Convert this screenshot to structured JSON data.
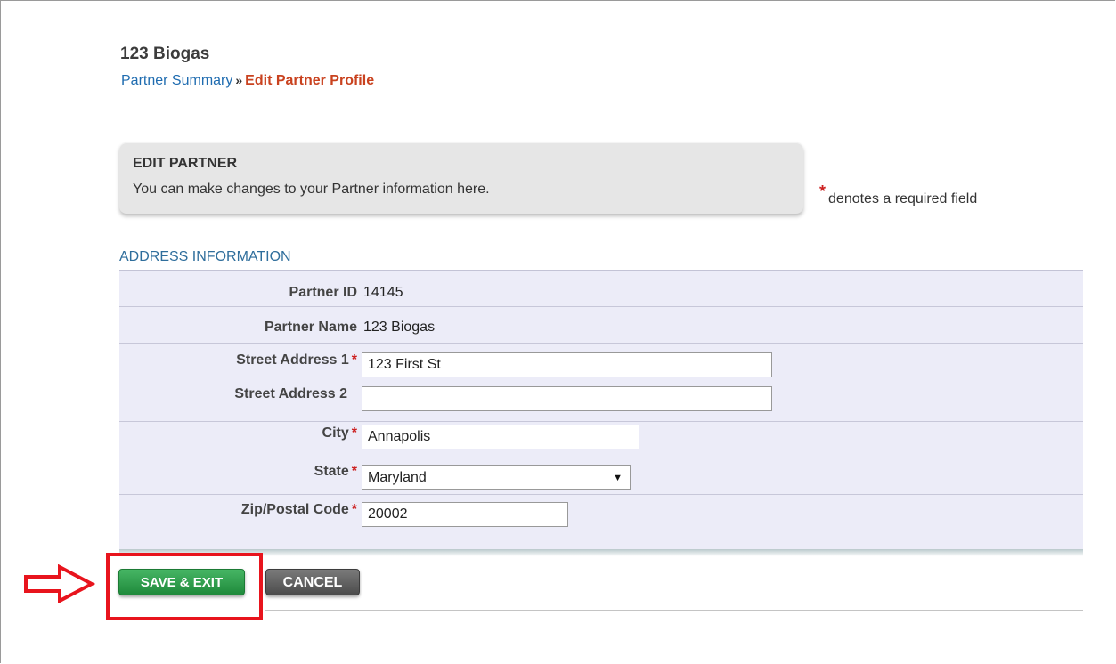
{
  "header": {
    "title": "123 Biogas",
    "breadcrumb": {
      "link": "Partner Summary",
      "separator": "»",
      "current": "Edit Partner Profile"
    }
  },
  "edit_box": {
    "title": "EDIT PARTNER",
    "description": "You can make changes to your Partner information here."
  },
  "required_note": {
    "star": "*",
    "text": "denotes a required field"
  },
  "section": {
    "title": "ADDRESS INFORMATION"
  },
  "form": {
    "partner_id": {
      "label": "Partner ID",
      "value": "14145"
    },
    "partner_name": {
      "label": "Partner Name",
      "value": "123 Biogas"
    },
    "street1": {
      "label": "Street Address 1",
      "value": "123 First St",
      "required": "*"
    },
    "street2": {
      "label": "Street Address 2",
      "value": ""
    },
    "city": {
      "label": "City",
      "value": "Annapolis",
      "required": "*"
    },
    "state": {
      "label": "State",
      "value": "Maryland",
      "required": "*"
    },
    "zip": {
      "label": "Zip/Postal Code",
      "value": "20002",
      "required": "*"
    }
  },
  "buttons": {
    "save_exit": "SAVE & EXIT",
    "cancel": "CANCEL"
  },
  "icons": {
    "state_dropdown": "triangle-down-icon",
    "annotation_arrow": "right-arrow-icon"
  },
  "colors": {
    "link": "#1f6cb0",
    "breadcrumb_current": "#c9421f",
    "required": "#cc1f1f",
    "save_button": "#2e9c4b",
    "cancel_button": "#5a5a5a",
    "annotation": "#e8141d",
    "form_background": "#ececf8"
  }
}
